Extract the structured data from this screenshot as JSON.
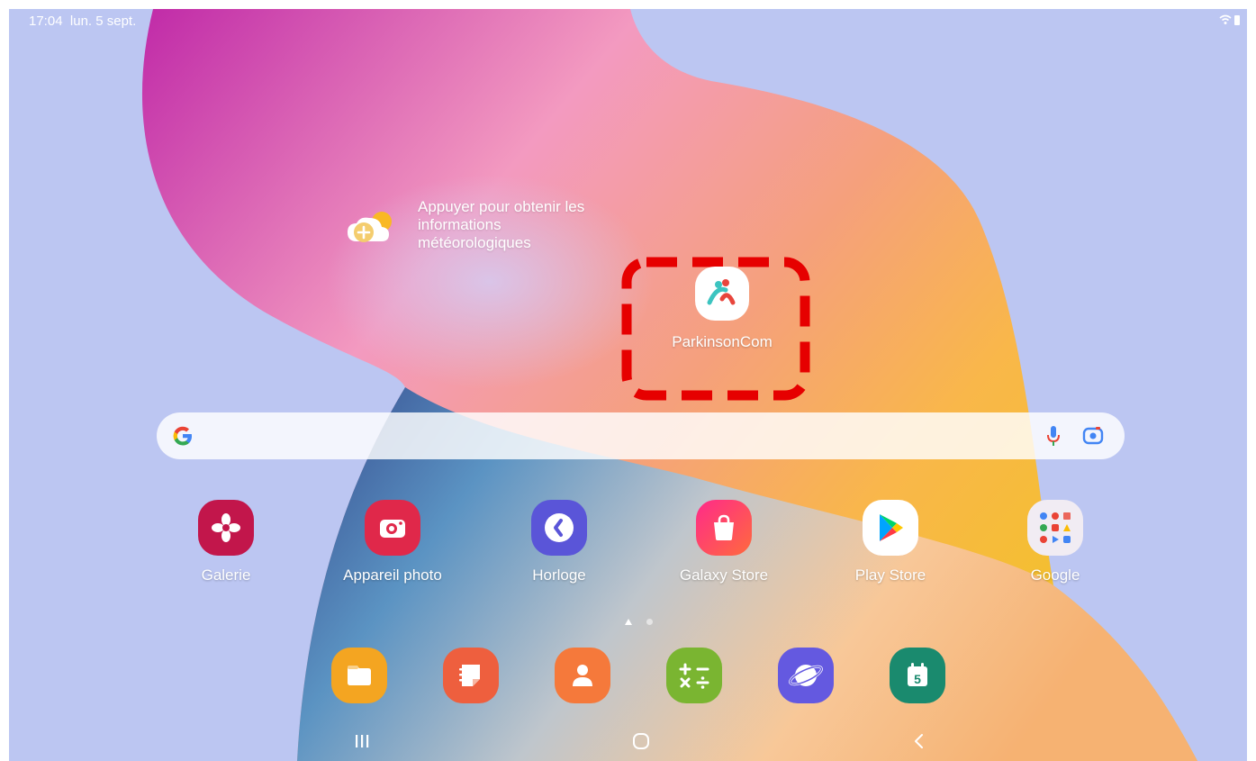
{
  "status": {
    "time": "17:04",
    "date": "lun. 5 sept."
  },
  "weather": {
    "prompt": "Appuyer pour obtenir les informations météorologiques"
  },
  "highlighted_app": {
    "label": "ParkinsonCom"
  },
  "apps": {
    "galerie": "Galerie",
    "camera": "Appareil photo",
    "horloge": "Horloge",
    "galaxy_store": "Galaxy Store",
    "play_store": "Play Store",
    "google": "Google"
  },
  "dock": {
    "calendar_day": "5",
    "calculator_symbols": "+−×÷"
  },
  "colors": {
    "background": "#bcc6f2",
    "galerie": "#c2164b",
    "camera": "#e0284a",
    "horloge": "#5a55d8",
    "galaxy_store": "#e9317a",
    "my_files": "#f4a521",
    "notes": "#ee5f3e",
    "contacts": "#f5793b",
    "calculator": "#7ab531",
    "internet": "#6459e0",
    "calendar": "#1a8a6e",
    "highlight": "#e60000"
  },
  "icons": [
    "wifi-icon",
    "battery-icon",
    "weather-add-icon",
    "google-g-icon",
    "microphone-icon",
    "lens-icon",
    "recent-apps-icon",
    "home-icon",
    "back-icon"
  ]
}
